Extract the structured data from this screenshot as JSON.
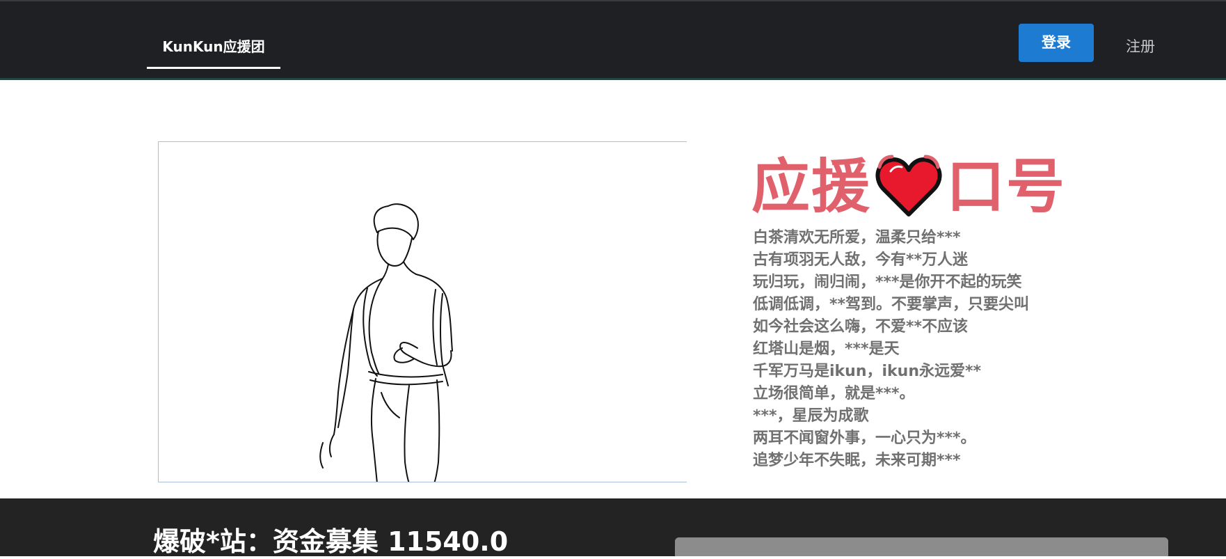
{
  "header": {
    "nav_tab": "KunKun应援团",
    "login_label": "登录",
    "register_label": "注册"
  },
  "hero": {
    "image_alt": "line drawing of a person in suspenders",
    "slogan_title_left": "应援",
    "slogan_title_right": "口号",
    "heart_icon": "heart-icon",
    "slogans": [
      "白茶清欢无所爱，温柔只给***",
      "古有项羽无人敌，今有**万人迷",
      "玩归玩，闹归闹，***是你开不起的玩笑",
      "低调低调，**驾到。不要掌声，只要尖叫",
      "如今社会这么嗨，不爱**不应该",
      "红塔山是烟，***是天",
      "千军万马是ikun，ikun永远爱**",
      "立场很简单，就是***。",
      "***，星辰为成歌",
      "两耳不闻窗外事，一心只为***。",
      "追梦少年不失眠，未来可期***"
    ]
  },
  "funding": {
    "title": "爆破*站：资金募集 11540.0"
  },
  "colors": {
    "navbar": "#1f2023",
    "accent_button": "#1e7bd2",
    "slogan_title": "#e0606c",
    "slogan_text": "#707070",
    "footer": "#232323"
  }
}
